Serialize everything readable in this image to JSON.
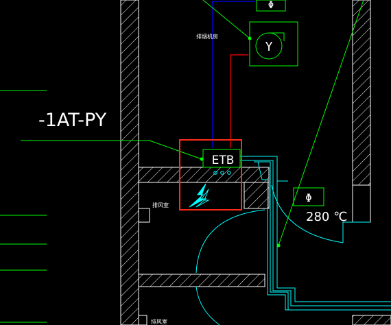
{
  "labels": {
    "equipment_tag": "-1AT-PY",
    "exhaust_fan_room": "排烟机房",
    "etb_box": "ETB",
    "fire_damper_temp": "280 ℃",
    "room_upper": "排风室",
    "room_lower": "排风室"
  },
  "symbols": {
    "fan_symbol": "Y",
    "damper_symbol_top": "Φ",
    "damper_symbol_right": "Φ"
  },
  "colors": {
    "background": "#000000",
    "wall_lines": "#ffffff",
    "leader_lines": "#00ff00",
    "duct_lines": "#00ffff",
    "blue_wire": "#0000ff",
    "red_wire": "#ff0000",
    "highlight_box": "#ff2a1a",
    "lightning_symbol": "#00ffff"
  },
  "icons": {
    "fan": "centrifugal-fan-icon",
    "damper": "fire-damper-icon",
    "lightning": "lightning-bolt-icon"
  }
}
